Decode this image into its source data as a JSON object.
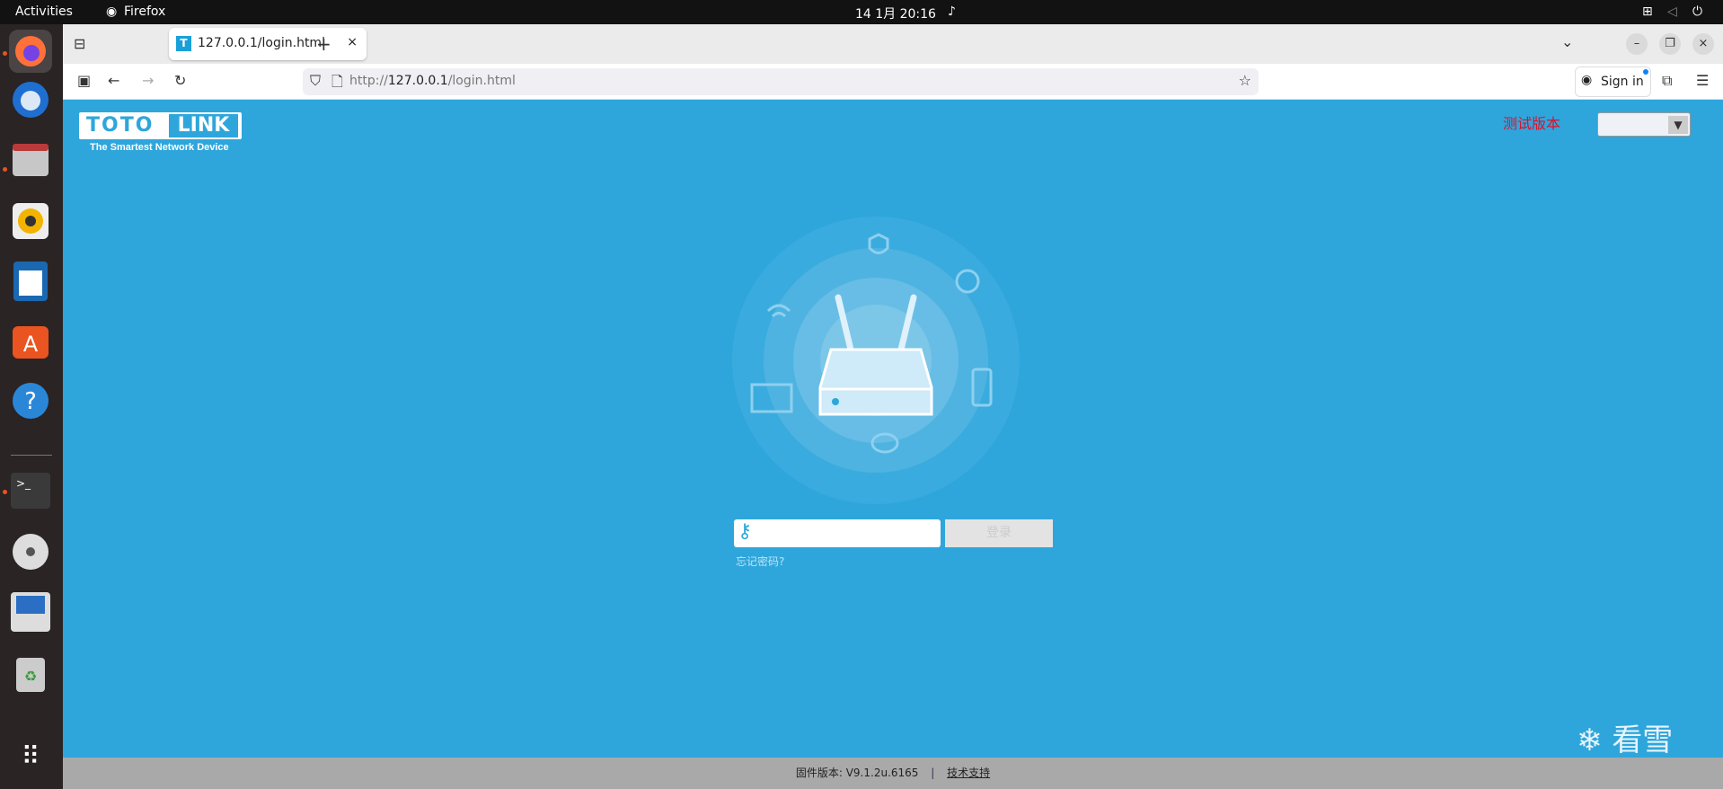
{
  "system": {
    "activities": "Activities",
    "app_name": "Firefox",
    "clock": "14 1月  20:16"
  },
  "browser": {
    "tab_title": "127.0.0.1/login.html",
    "url_prefix": "http://",
    "url_host": "127.0.0.1",
    "url_path": "/login.html",
    "sign_in": "Sign in"
  },
  "page": {
    "logo_left": "TOTO",
    "logo_right": "LINK",
    "logo_tagline": "The Smartest Network Device",
    "test_version": "测试版本",
    "language_select_value": "",
    "password_placeholder": "",
    "login_button": "登录",
    "forgot_password": "忘记密码?",
    "firmware_label": "固件版本: V9.1.2u.6165",
    "separator": "|",
    "support_link": "技术支持",
    "watermark": "看雪"
  },
  "colors": {
    "background": "#2ea6dc",
    "test_version": "#e0102a",
    "footer": "#a9a9a9"
  }
}
